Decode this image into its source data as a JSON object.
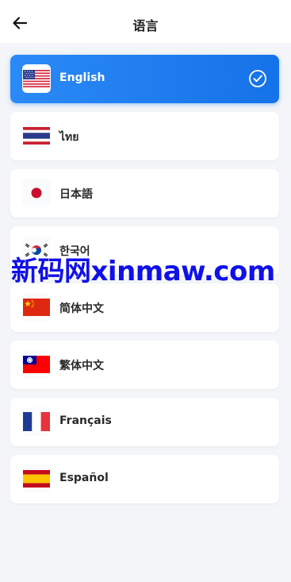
{
  "header": {
    "title": "语言"
  },
  "languages": [
    {
      "label": "English",
      "flag": "us-flag-icon",
      "selected": true
    },
    {
      "label": "ไทย",
      "flag": "th-flag-icon",
      "selected": false
    },
    {
      "label": "日本語",
      "flag": "jp-flag-icon",
      "selected": false
    },
    {
      "label": "한국어",
      "flag": "kr-flag-icon",
      "selected": false
    },
    {
      "label": "简体中文",
      "flag": "cn-flag-icon",
      "selected": false
    },
    {
      "label": "繁体中文",
      "flag": "tw-flag-icon",
      "selected": false
    },
    {
      "label": "Français",
      "flag": "fr-flag-icon",
      "selected": false
    },
    {
      "label": "Español",
      "flag": "es-flag-icon",
      "selected": false
    }
  ],
  "watermark": {
    "text": "新码网xinmaw.com"
  },
  "colors": {
    "accent": "#1a7cf0",
    "background": "#f3f5f8",
    "watermark": "#1010e8"
  }
}
